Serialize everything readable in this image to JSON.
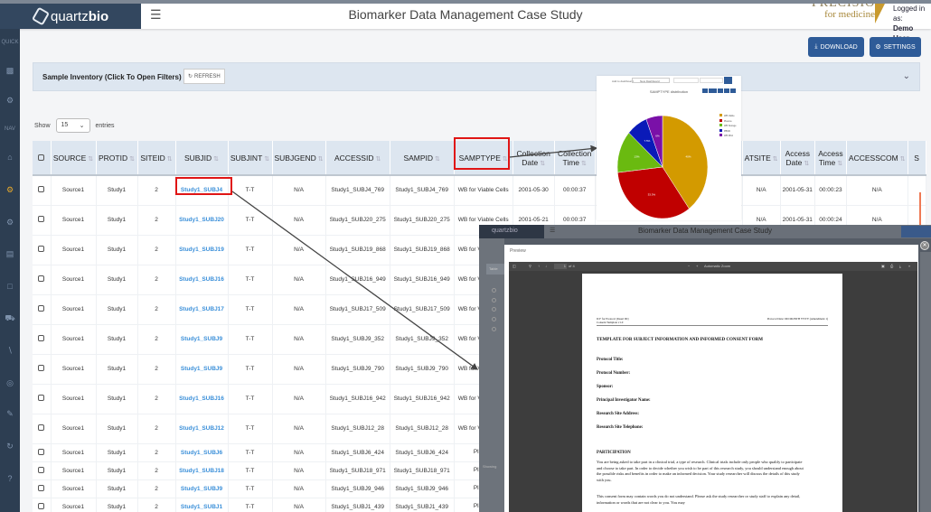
{
  "app": {
    "logo_text": "quartz",
    "logo_bold": "bio",
    "title": "Biomarker Data Management Case Study",
    "brand_line1": "PRECISION",
    "brand_line2": "for medicine",
    "login_label": "Logged in as:",
    "login_user": "Demo User"
  },
  "sidebar": {
    "label_top": "QUICK",
    "label_mid": "NAV",
    "icons": [
      "cogs-icon",
      "database-icon",
      "cogs-icon",
      "home-icon",
      "cogs-icon",
      "cogs-icon",
      "bar-chart-icon",
      "file-icon",
      "car-icon",
      "paperclip-icon",
      "circle-icon",
      "pencil-icon",
      "refresh-icon",
      "help-icon"
    ]
  },
  "toolbar": {
    "download_label": "DOWNLOAD",
    "settings_label": "SETTINGS"
  },
  "panel": {
    "title": "Sample Inventory (Click To Open Filters)",
    "refresh_label": "REFRESH"
  },
  "show_entries": {
    "show_label": "Show",
    "value": "15",
    "entries_label": "entries"
  },
  "table": {
    "columns": [
      "SOURCE",
      "PROTID",
      "SITEID",
      "SUBJID",
      "SUBJINT",
      "SUBJGEND",
      "ACCESSID",
      "SAMPID",
      "SAMPTYPE",
      "Collection Date",
      "Collection Time",
      "",
      "ATSITE",
      "Access Date",
      "Access Time",
      "ACCESSCOM",
      "S"
    ],
    "rows": [
      {
        "source": "Source1",
        "protid": "Study1",
        "siteid": "2",
        "subjid": "Study1_SUBJ4",
        "subjint": "T-T",
        "subjgend": "N/A",
        "accessid": "Study1_SUBJ4_769",
        "sampid": "Study1_SUBJ4_769",
        "samptype": "WB for Viable Cells",
        "coldate": "2001-05-30",
        "coltime": "00:00:37",
        "atsite": "N/A",
        "accdate": "2001-05-31",
        "acctime": "00:00:23",
        "accesscom": "N/A"
      },
      {
        "source": "Source1",
        "protid": "Study1",
        "siteid": "2",
        "subjid": "Study1_SUBJ20",
        "subjint": "T-T",
        "subjgend": "N/A",
        "accessid": "Study1_SUBJ20_275",
        "sampid": "Study1_SUBJ20_275",
        "samptype": "WB for Viable Cells",
        "coldate": "2001-05-21",
        "coltime": "00:00:37",
        "atsite": "N/A",
        "accdate": "2001-05-31",
        "acctime": "00:00:24",
        "accesscom": "N/A"
      },
      {
        "source": "Source1",
        "protid": "Study1",
        "siteid": "2",
        "subjid": "Study1_SUBJ19",
        "subjint": "T-T",
        "subjgend": "N/A",
        "accessid": "Study1_SUBJ19_868",
        "sampid": "Study1_SUBJ19_868",
        "samptype": "WB for Viable Cells"
      },
      {
        "source": "Source1",
        "protid": "Study1",
        "siteid": "2",
        "subjid": "Study1_SUBJ16",
        "subjint": "T-T",
        "subjgend": "N/A",
        "accessid": "Study1_SUBJ16_949",
        "sampid": "Study1_SUBJ16_949",
        "samptype": "WB for Viable Cells"
      },
      {
        "source": "Source1",
        "protid": "Study1",
        "siteid": "2",
        "subjid": "Study1_SUBJ17",
        "subjint": "T-T",
        "subjgend": "N/A",
        "accessid": "Study1_SUBJ17_509",
        "sampid": "Study1_SUBJ17_509",
        "samptype": "WB for Viable Cells"
      },
      {
        "source": "Source1",
        "protid": "Study1",
        "siteid": "2",
        "subjid": "Study1_SUBJ9",
        "subjint": "T-T",
        "subjgend": "N/A",
        "accessid": "Study1_SUBJ9_352",
        "sampid": "Study1_SUBJ9_352",
        "samptype": "WB for Viable Cells"
      },
      {
        "source": "Source1",
        "protid": "Study1",
        "siteid": "2",
        "subjid": "Study1_SUBJ9",
        "subjint": "T-T",
        "subjgend": "N/A",
        "accessid": "Study1_SUBJ9_790",
        "sampid": "Study1_SUBJ9_790",
        "samptype": "WB for Viable Cells"
      },
      {
        "source": "Source1",
        "protid": "Study1",
        "siteid": "2",
        "subjid": "Study1_SUBJ16",
        "subjint": "T-T",
        "subjgend": "N/A",
        "accessid": "Study1_SUBJ16_942",
        "sampid": "Study1_SUBJ16_942",
        "samptype": "WB for Viable Cells"
      },
      {
        "source": "Source1",
        "protid": "Study1",
        "siteid": "2",
        "subjid": "Study1_SUBJ12",
        "subjint": "T-T",
        "subjgend": "N/A",
        "accessid": "Study1_SUBJ12_28",
        "sampid": "Study1_SUBJ12_28",
        "samptype": "WB for Viable Cells"
      },
      {
        "source": "Source1",
        "protid": "Study1",
        "siteid": "2",
        "subjid": "Study1_SUBJ6",
        "subjint": "T-T",
        "subjgend": "N/A",
        "accessid": "Study1_SUBJ6_424",
        "sampid": "Study1_SUBJ6_424",
        "samptype": "Plasma"
      },
      {
        "source": "Source1",
        "protid": "Study1",
        "siteid": "2",
        "subjid": "Study1_SUBJ18",
        "subjint": "T-T",
        "subjgend": "N/A",
        "accessid": "Study1_SUBJ18_971",
        "sampid": "Study1_SUBJ18_971",
        "samptype": "Plasma"
      },
      {
        "source": "Source1",
        "protid": "Study1",
        "siteid": "2",
        "subjid": "Study1_SUBJ9",
        "subjint": "T-T",
        "subjgend": "N/A",
        "accessid": "Study1_SUBJ9_946",
        "sampid": "Study1_SUBJ9_946",
        "samptype": "Plasma"
      },
      {
        "source": "Source1",
        "protid": "Study1",
        "siteid": "2",
        "subjid": "Study1_SUBJ1",
        "subjint": "T-T",
        "subjgend": "N/A",
        "accessid": "Study1_SUBJ1_439",
        "sampid": "Study1_SUBJ1_439",
        "samptype": "Plasma"
      }
    ]
  },
  "pie_popup": {
    "dashboard_label": "Add to dashboard",
    "dashboard_select": "New Dashboard",
    "title": "SAMPTYPE distribution",
    "colors": [
      "#d39a00",
      "#c00000",
      "#6aba10",
      "#0a1ab8",
      "#7a10a8"
    ]
  },
  "chart_data": {
    "type": "pie",
    "title": "SAMPTYPE distribution",
    "labels": [
      "WB Viable",
      "Plasma",
      "WB Storage",
      "PBMC",
      "WB RNA"
    ],
    "values": [
      40,
      33.3,
      13.3,
      7.5,
      5.9
    ],
    "value_labels": [
      "40%",
      "33.3%",
      "13%",
      "7.5%",
      "6%"
    ],
    "legend": "right"
  },
  "overlay": {
    "logo": "quartzbio",
    "title": "Biomarker Data Management Case Study",
    "preview_label": "Preview",
    "side_tab": "Table",
    "side_footer": "Showing",
    "pdf": {
      "page_input": "1",
      "page_total": "of 4",
      "zoom": "Automatic Zoom",
      "header_left_1": "ICF for Protocol [Insert ID]",
      "header_left_2": "Consent Template v1.0",
      "header_right": "Protocol Date: DD MONTH YYYY (Amendment 1)",
      "heading": "TEMPLATE FOR SUBJECT INFORMATION AND INFORMED CONSENT FORM",
      "fields": [
        "Protocol Title:",
        "Protocol Number:",
        "Sponsor:",
        "Principal Investigator Name:",
        "Research Site Address:",
        "Research Site Telephone:"
      ],
      "section": "PARTICIPATION",
      "para1": "You are being asked to take part in a clinical trial, a type of research. Clinical trials include only people who qualify to participate and choose to take part. In order to decide whether you wish to be part of this research study, you should understand enough about the possible risks and benefits in order to make an informed decision. Your study researcher will discuss the details of this study with you.",
      "para2": "This consent form may contain words you do not understand. Please ask the study researcher or study staff to explain any detail, information or words that are not clear to you. You may"
    }
  }
}
